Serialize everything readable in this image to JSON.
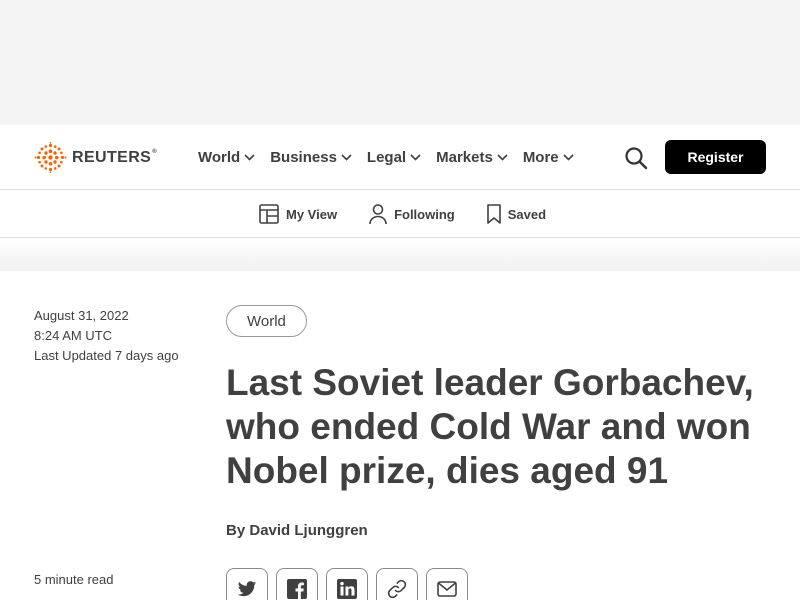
{
  "header": {
    "logo_text": "REUTERS",
    "logo_reg": "®",
    "nav": [
      {
        "label": "World"
      },
      {
        "label": "Business"
      },
      {
        "label": "Legal"
      },
      {
        "label": "Markets"
      },
      {
        "label": "More"
      }
    ],
    "register_label": "Register"
  },
  "subnav": {
    "items": [
      {
        "label": "My View",
        "icon": "layout-icon"
      },
      {
        "label": "Following",
        "icon": "person-icon"
      },
      {
        "label": "Saved",
        "icon": "bookmark-icon"
      }
    ]
  },
  "article": {
    "date": "August 31, 2022",
    "time": "8:24 AM UTC",
    "updated": "Last Updated 7 days ago",
    "read_time": "5 minute read",
    "tag": "World",
    "headline": "Last Soviet leader Gorbachev, who ended Cold War and won Nobel prize, dies aged 91",
    "byline_prefix": "By",
    "author": "David Ljunggren"
  },
  "share_icons": [
    "twitter-icon",
    "facebook-icon",
    "linkedin-icon",
    "link-icon",
    "email-icon"
  ],
  "colors": {
    "brand_orange": "#fa6400",
    "text": "#404040",
    "button_bg": "#000000",
    "ad_bg": "#f4f4f4"
  }
}
